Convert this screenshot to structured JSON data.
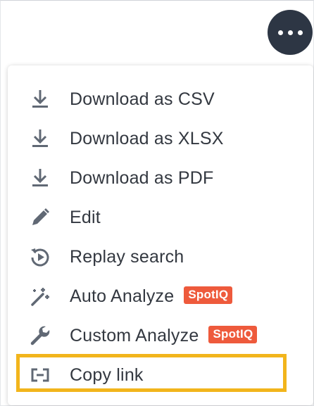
{
  "more_button": {
    "icon": "more-horizontal-icon"
  },
  "menu": {
    "items": [
      {
        "label": "Download as CSV",
        "icon": "download-icon"
      },
      {
        "label": "Download as XLSX",
        "icon": "download-icon"
      },
      {
        "label": "Download as PDF",
        "icon": "download-icon"
      },
      {
        "label": "Edit",
        "icon": "pencil-icon"
      },
      {
        "label": "Replay search",
        "icon": "replay-icon"
      },
      {
        "label": "Auto Analyze",
        "icon": "magic-wand-icon",
        "badge": "SpotIQ"
      },
      {
        "label": "Custom Analyze",
        "icon": "wrench-icon",
        "badge": "SpotIQ"
      },
      {
        "label": "Copy link",
        "icon": "link-icon",
        "highlighted": true
      }
    ]
  },
  "colors": {
    "button_bg": "#2d3644",
    "text": "#333840",
    "icon": "#606874",
    "badge": "#ee5a3c",
    "highlight": "#f2b51c"
  }
}
